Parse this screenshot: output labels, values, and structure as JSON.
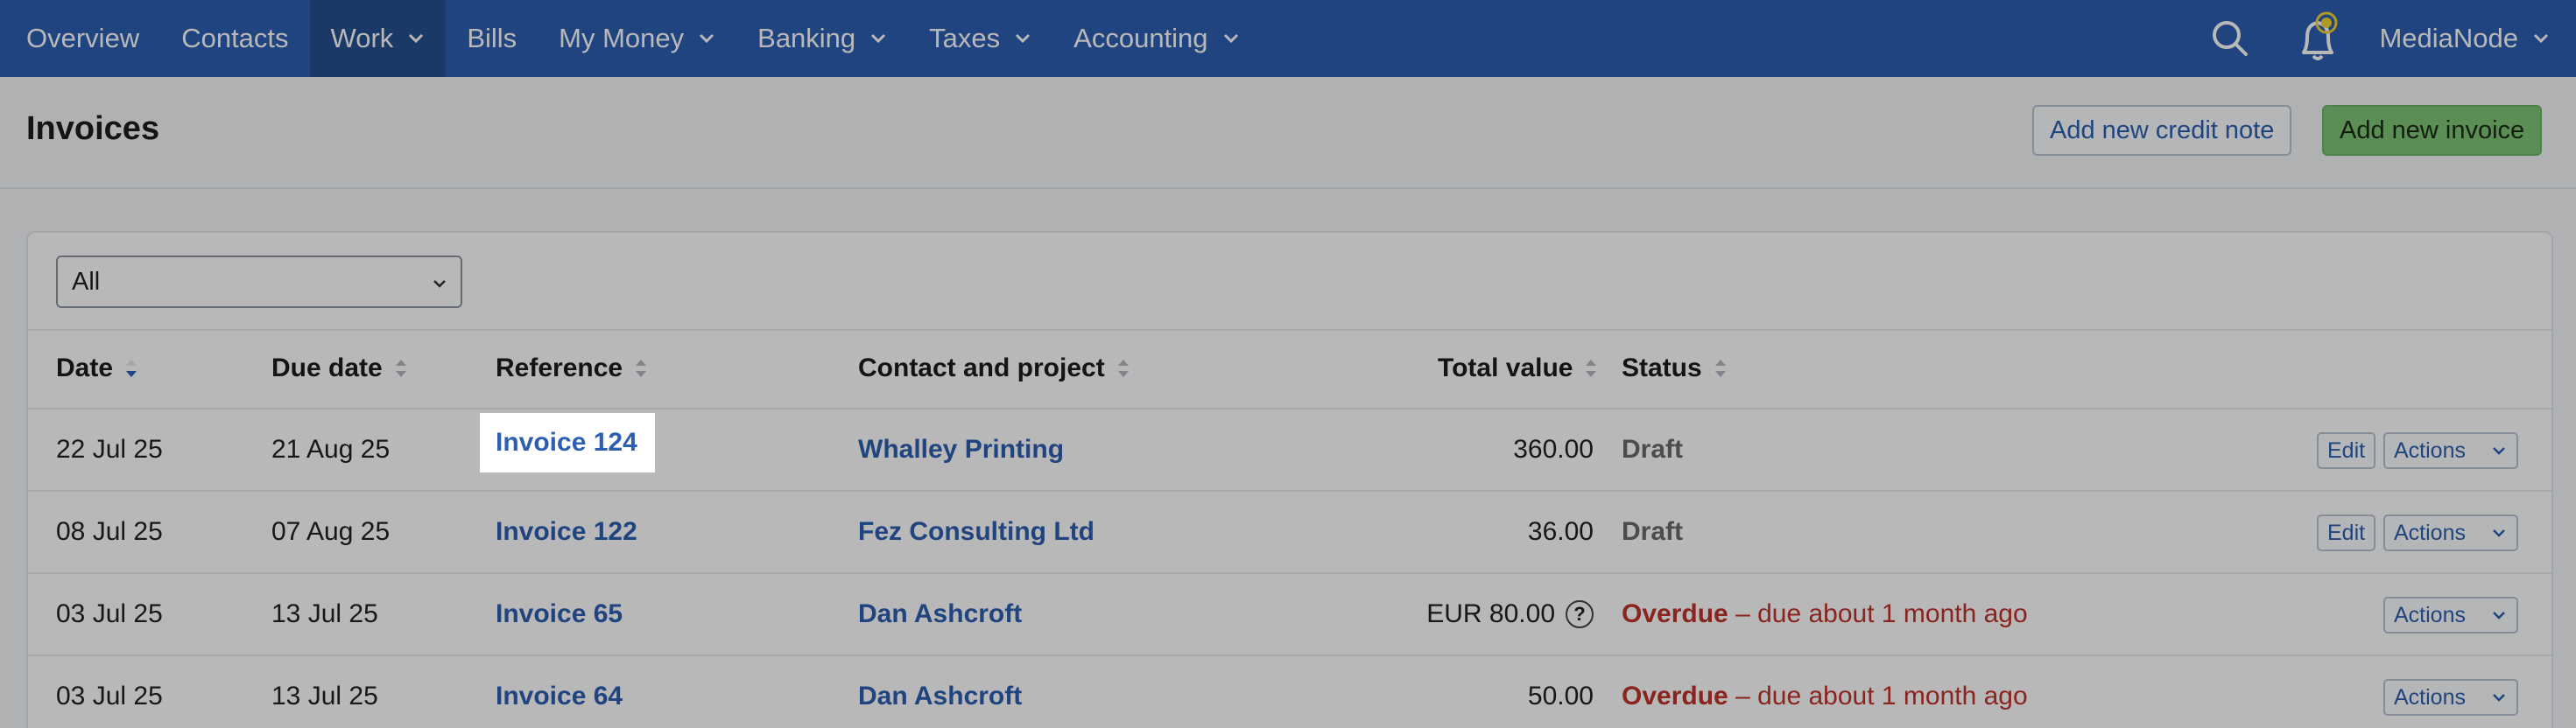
{
  "nav": {
    "items": [
      {
        "label": "Overview",
        "dropdown": false
      },
      {
        "label": "Contacts",
        "dropdown": false
      },
      {
        "label": "Work",
        "dropdown": true,
        "active": true
      },
      {
        "label": "Bills",
        "dropdown": false
      },
      {
        "label": "My Money",
        "dropdown": true
      },
      {
        "label": "Banking",
        "dropdown": true
      },
      {
        "label": "Taxes",
        "dropdown": true
      },
      {
        "label": "Accounting",
        "dropdown": true
      }
    ],
    "user": "MediaNode",
    "icons": [
      "search-icon",
      "bell-icon"
    ],
    "colors": {
      "bar": "#2d5fb0",
      "active": "#24508f",
      "notification": "#f2d530"
    }
  },
  "page": {
    "title": "Invoices",
    "credit_button": "Add new credit note",
    "invoice_button": "Add new invoice"
  },
  "filter": {
    "value": "All"
  },
  "table": {
    "headers": {
      "date": "Date",
      "due": "Due date",
      "ref": "Reference",
      "contact": "Contact and project",
      "total": "Total value",
      "status": "Status"
    },
    "sort_active": "date",
    "rows": [
      {
        "date": "22 Jul 25",
        "due": "21 Aug 25",
        "ref": "Invoice 124",
        "contact": "Whalley Printing",
        "total": "360.00",
        "status": "Draft",
        "status_note": "",
        "edit": "Edit",
        "actions": "Actions",
        "help": false
      },
      {
        "date": "08 Jul 25",
        "due": "07 Aug 25",
        "ref": "Invoice 122",
        "contact": "Fez Consulting Ltd",
        "total": "36.00",
        "status": "Draft",
        "status_note": "",
        "edit": "Edit",
        "actions": "Actions",
        "help": false
      },
      {
        "date": "03 Jul 25",
        "due": "13 Jul 25",
        "ref": "Invoice 65",
        "contact": "Dan Ashcroft",
        "total": "EUR 80.00",
        "status": "Overdue",
        "status_note": "– due about 1 month ago",
        "edit": "",
        "actions": "Actions",
        "help": true
      },
      {
        "date": "03 Jul 25",
        "due": "13 Jul 25",
        "ref": "Invoice 64",
        "contact": "Dan Ashcroft",
        "total": "50.00",
        "status": "Overdue",
        "status_note": "– due about 1 month ago",
        "edit": "",
        "actions": "Actions",
        "help": false
      }
    ]
  },
  "highlighted": "Invoice 124"
}
